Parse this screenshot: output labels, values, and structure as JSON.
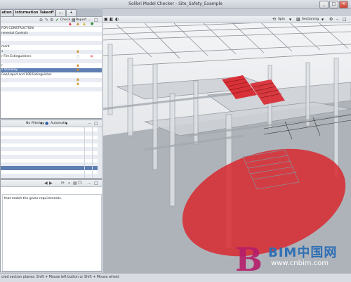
{
  "window": {
    "title": "Solibri Model Checker - Site_Safety_Example",
    "minimize": "_",
    "maximize": "□",
    "close": "✕"
  },
  "tabs": [
    {
      "label": "ation"
    },
    {
      "label": "Information Takeoff"
    },
    {
      "label": "..."
    },
    {
      "label": "+"
    }
  ],
  "rules_toolbar": {
    "check_label": "Check",
    "report_label": "Report"
  },
  "rules_tree": [
    {
      "label": "FOR CONSTRUCTION",
      "style": "normal",
      "severity": ""
    },
    {
      "label": "nmental Controls",
      "style": "alt",
      "severity": ""
    },
    {
      "label": "",
      "style": "normal",
      "severity": ""
    },
    {
      "label": "",
      "style": "alt",
      "severity": ""
    },
    {
      "label": "ment",
      "style": "normal",
      "severity": ""
    },
    {
      "label": "s",
      "style": "alt",
      "severity": "warn"
    },
    {
      "label": "r Fire Extinguishers",
      "style": "normal",
      "severity": "ok-x"
    },
    {
      "label": "",
      "style": "alt",
      "severity": ""
    },
    {
      "label": "r",
      "style": "normal",
      "severity": "warn"
    },
    {
      "label": "s Stairway",
      "style": "sel",
      "severity": "warn"
    },
    {
      "label": "Gas/Liquid and 10B Extinguisher",
      "style": "normal",
      "severity": ""
    },
    {
      "label": "",
      "style": "alt",
      "severity": "warn"
    },
    {
      "label": "",
      "style": "normal",
      "severity": "warn"
    },
    {
      "label": "",
      "style": "alt",
      "severity": ""
    }
  ],
  "results_toolbar": {
    "filter_label": "No Filtering",
    "mode_label": "Automatic"
  },
  "results_rows": [
    {
      "style": "normal"
    },
    {
      "style": "alt"
    },
    {
      "style": "normal"
    },
    {
      "style": "alt"
    },
    {
      "style": "normal"
    },
    {
      "style": "alt"
    },
    {
      "style": "normal"
    },
    {
      "style": "alt"
    },
    {
      "style": "normal"
    },
    {
      "style": "alt"
    },
    {
      "style": "sel"
    },
    {
      "style": "normal"
    },
    {
      "style": "alt"
    }
  ],
  "info_panel": {
    "description": "that match the given requirements."
  },
  "viewer_toolbar": {
    "spin_label": "Spin",
    "sectioning_label": "Sectioning"
  },
  "status_bar": {
    "text": "cted section planes: Shift + Mouse left button or Shift + Mouse wheel."
  },
  "watermark": {
    "brand": "BIM中国网",
    "url": "www.cnbim.com"
  },
  "colors": {
    "section_red": "#d8282f",
    "selection_blue": "#5f7fb3"
  }
}
